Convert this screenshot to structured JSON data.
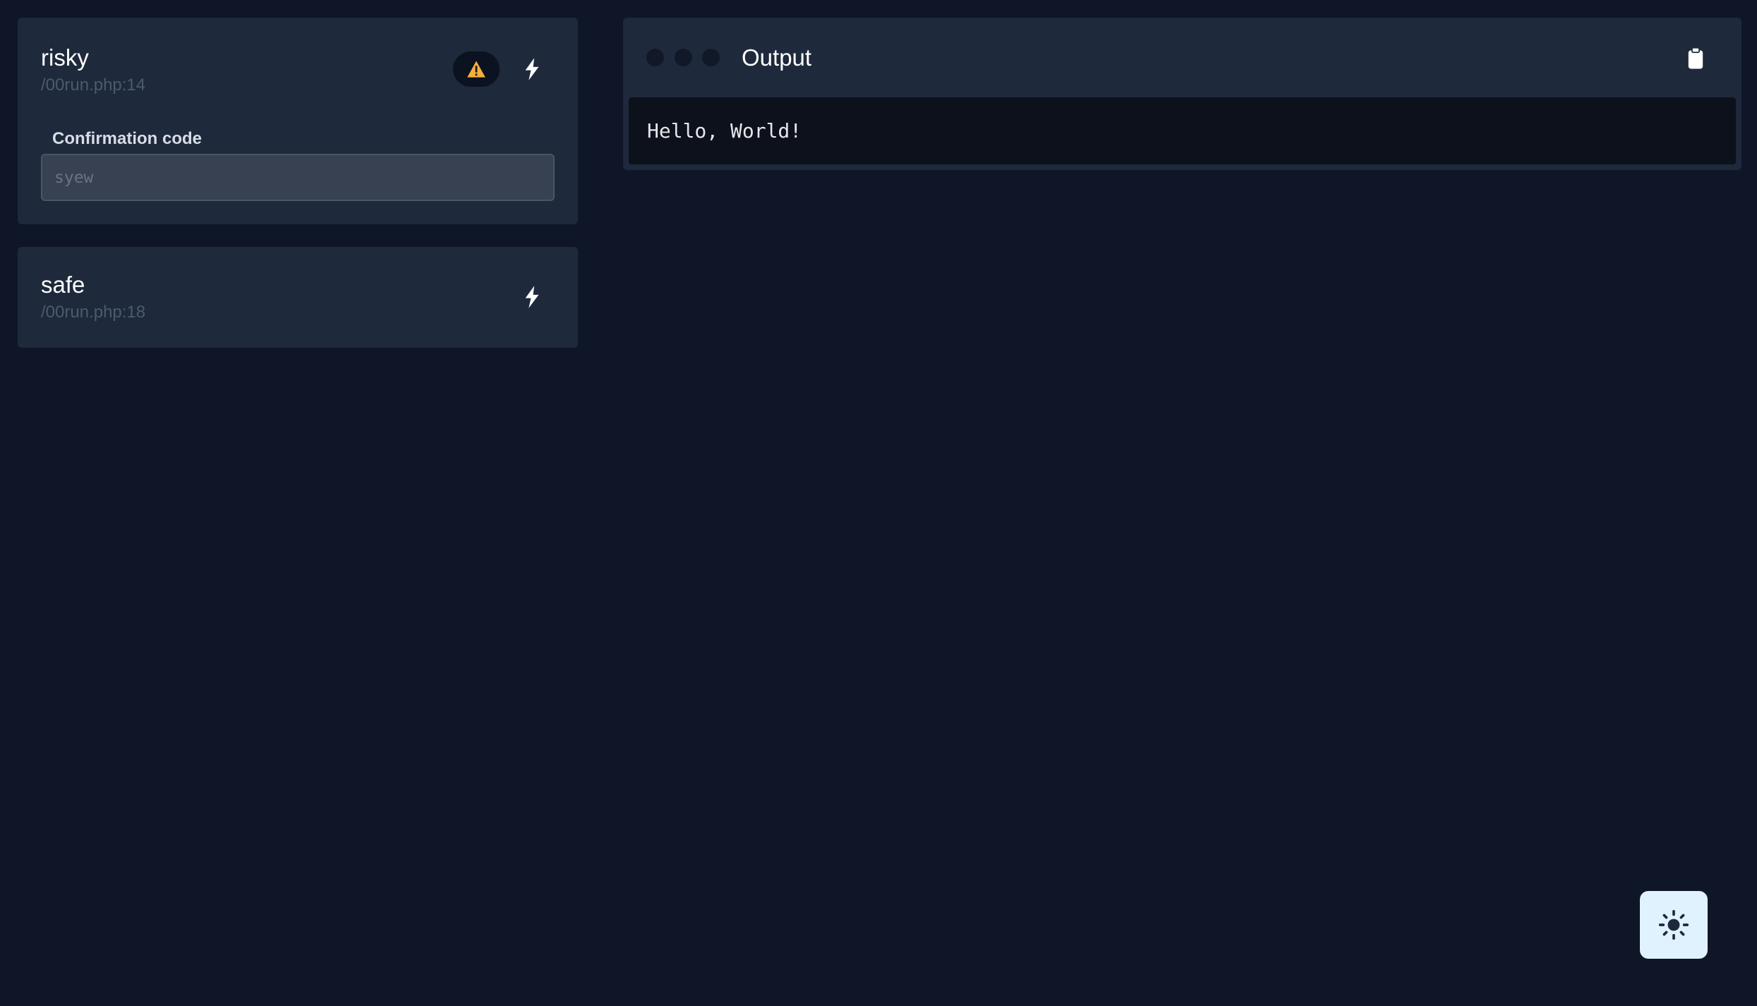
{
  "tasks": [
    {
      "name": "risky",
      "location": "/00run.php:14",
      "dangerous": true,
      "confirmation": {
        "label": "Confirmation code",
        "placeholder": "syew",
        "value": ""
      }
    },
    {
      "name": "safe",
      "location": "/00run.php:18",
      "dangerous": false
    }
  ],
  "output": {
    "title": "Output",
    "text": "Hello, World!"
  },
  "icons": {
    "warning": "warning-icon",
    "run": "lightning-bolt-icon",
    "copy": "clipboard-icon",
    "theme": "sun-icon"
  },
  "colors": {
    "background": "#0e1628",
    "card": "#1e293b",
    "warning": "#f59e0b",
    "console": "#0c111b",
    "theme_button": "#e0f2fe"
  }
}
